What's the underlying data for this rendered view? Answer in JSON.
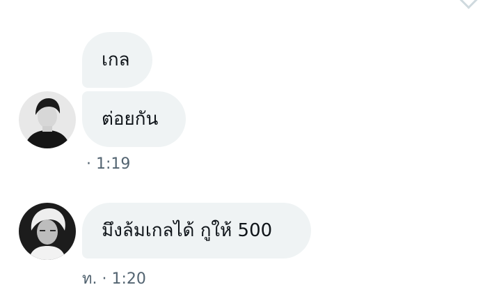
{
  "thread": {
    "groups": [
      {
        "sender": "other-user-1",
        "avatar_icon": "user-avatar-photo-dark-hair",
        "messages": [
          "เกล",
          "ต่อยกัน"
        ],
        "timestamp": "· 1:19"
      },
      {
        "sender": "other-user-2",
        "avatar_icon": "user-avatar-photo-light-hair",
        "messages": [
          "มึงล้มเกลได้ กูให้ 500"
        ],
        "timestamp": "ท. · 1:20"
      }
    ]
  },
  "colors": {
    "bubble_bg": "#eff3f4",
    "text": "#0f1419",
    "timestamp": "#536471",
    "chevron": "#cfd9de"
  }
}
